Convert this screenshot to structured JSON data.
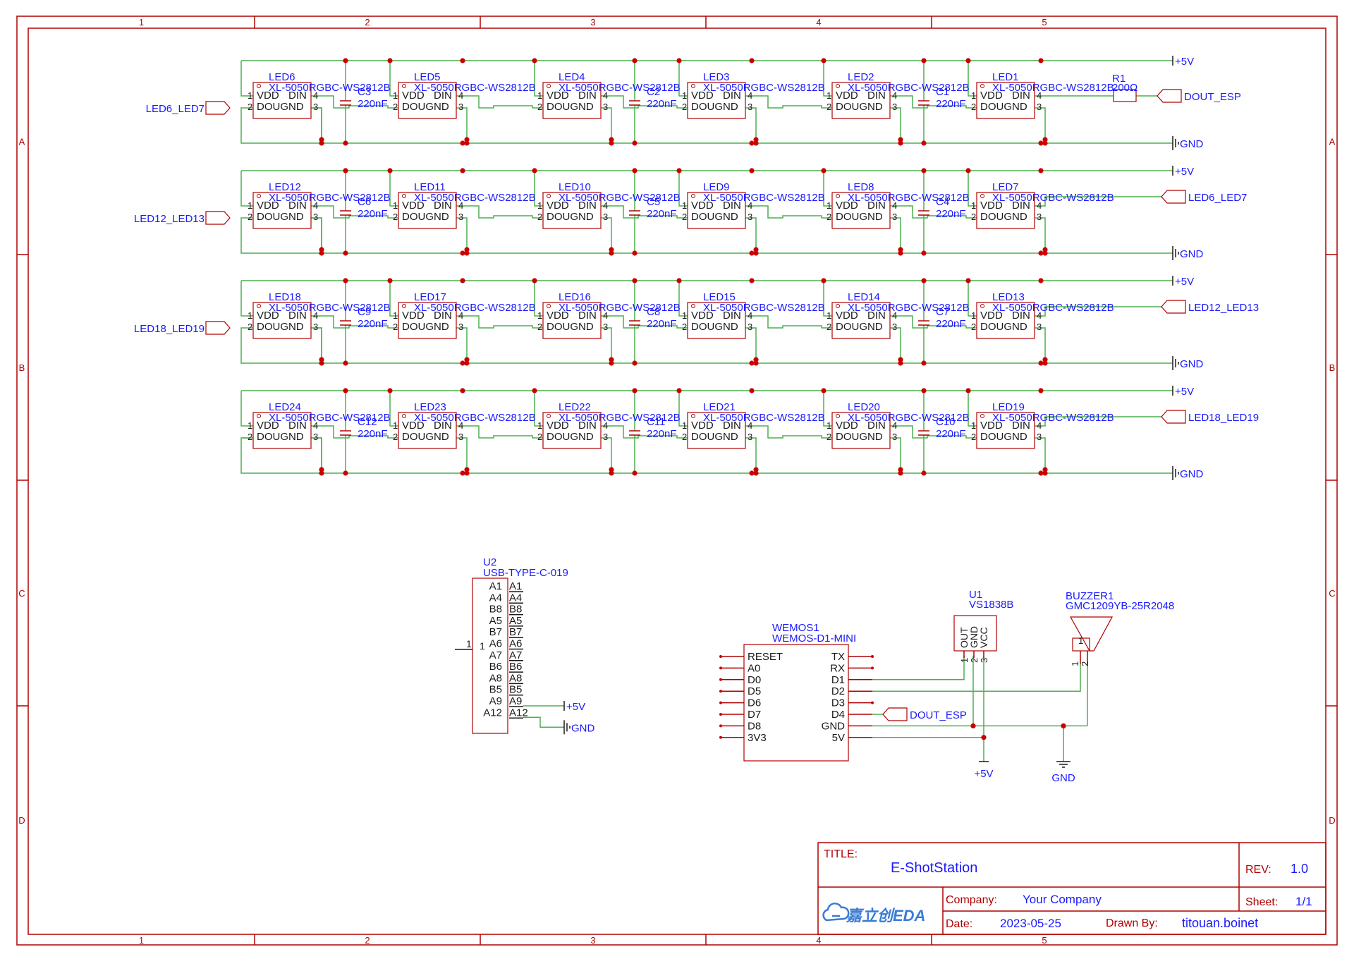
{
  "border": {
    "cols": [
      "1",
      "2",
      "3",
      "4",
      "5"
    ],
    "rows": [
      "A",
      "B",
      "C",
      "D"
    ]
  },
  "colors": {
    "wire": "#4caf50",
    "junction": "#cc0000",
    "frame": "#b00000",
    "label": "#1a1aff",
    "pin": "#1a1a1a"
  },
  "led_rows": [
    {
      "leds": [
        {
          "ref": "LED6",
          "part": "XL-5050RGBC-WS2812B"
        },
        {
          "ref": "LED5",
          "part": "XL-5050RGBC-WS2812B"
        },
        {
          "ref": "LED4",
          "part": "XL-5050RGBC-WS2812B"
        },
        {
          "ref": "LED3",
          "part": "XL-5050RGBC-WS2812B"
        },
        {
          "ref": "LED2",
          "part": "XL-5050RGBC-WS2812B"
        },
        {
          "ref": "LED1",
          "part": "XL-5050RGBC-WS2812B"
        }
      ],
      "caps": [
        {
          "ref": "C3",
          "value": "220nF"
        },
        {
          "ref": "C2",
          "value": "220nF"
        },
        {
          "ref": "C1",
          "value": "220nF"
        }
      ],
      "in_label": "LED6_LED7",
      "out_label": "DOUT_ESP",
      "resistor": {
        "ref": "R1",
        "value": "200Ω"
      },
      "vcc": "+5V",
      "gnd": "GND"
    },
    {
      "leds": [
        {
          "ref": "LED12",
          "part": "XL-5050RGBC-WS2812B"
        },
        {
          "ref": "LED11",
          "part": "XL-5050RGBC-WS2812B"
        },
        {
          "ref": "LED10",
          "part": "XL-5050RGBC-WS2812B"
        },
        {
          "ref": "LED9",
          "part": "XL-5050RGBC-WS2812B"
        },
        {
          "ref": "LED8",
          "part": "XL-5050RGBC-WS2812B"
        },
        {
          "ref": "LED7",
          "part": "XL-5050RGBC-WS2812B"
        }
      ],
      "caps": [
        {
          "ref": "C6",
          "value": "220nF"
        },
        {
          "ref": "C5",
          "value": "220nF"
        },
        {
          "ref": "C4",
          "value": "220nF"
        }
      ],
      "in_label": "LED12_LED13",
      "out_label": "LED6_LED7",
      "vcc": "+5V",
      "gnd": "GND"
    },
    {
      "leds": [
        {
          "ref": "LED18",
          "part": "XL-5050RGBC-WS2812B"
        },
        {
          "ref": "LED17",
          "part": "XL-5050RGBC-WS2812B"
        },
        {
          "ref": "LED16",
          "part": "XL-5050RGBC-WS2812B"
        },
        {
          "ref": "LED15",
          "part": "XL-5050RGBC-WS2812B"
        },
        {
          "ref": "LED14",
          "part": "XL-5050RGBC-WS2812B"
        },
        {
          "ref": "LED13",
          "part": "XL-5050RGBC-WS2812B"
        }
      ],
      "caps": [
        {
          "ref": "C9",
          "value": "220nF"
        },
        {
          "ref": "C8",
          "value": "220nF"
        },
        {
          "ref": "C7",
          "value": "220nF"
        }
      ],
      "in_label": "LED18_LED19",
      "out_label": "LED12_LED13",
      "vcc": "+5V",
      "gnd": "GND"
    },
    {
      "leds": [
        {
          "ref": "LED24",
          "part": "XL-5050RGBC-WS2812B"
        },
        {
          "ref": "LED23",
          "part": "XL-5050RGBC-WS2812B"
        },
        {
          "ref": "LED22",
          "part": "XL-5050RGBC-WS2812B"
        },
        {
          "ref": "LED21",
          "part": "XL-5050RGBC-WS2812B"
        },
        {
          "ref": "LED20",
          "part": "XL-5050RGBC-WS2812B"
        },
        {
          "ref": "LED19",
          "part": "XL-5050RGBC-WS2812B"
        }
      ],
      "caps": [
        {
          "ref": "C12",
          "value": "220nF"
        },
        {
          "ref": "C11",
          "value": "220nF"
        },
        {
          "ref": "C10",
          "value": "220nF"
        }
      ],
      "in_label": "",
      "out_label": "LED18_LED19",
      "vcc": "+5V",
      "gnd": "GND"
    }
  ],
  "led_pins": {
    "vdd": "VDD",
    "din": "DIN",
    "dout": "DOUGND",
    "p1": "1",
    "p2": "2",
    "p3": "3",
    "p4": "4"
  },
  "usb": {
    "ref": "U2",
    "part": "USB-TYPE-C-019",
    "left_pins": [
      "A1",
      "A4",
      "B8",
      "A5",
      "B7",
      "A6",
      "A7",
      "B6",
      "A8",
      "B5",
      "A9",
      "A12"
    ],
    "right_pins": [
      "A1",
      "A4",
      "B8",
      "A5",
      "B7",
      "A6",
      "A7",
      "B6",
      "A8",
      "B5",
      "A9",
      "A12"
    ],
    "pin1": "1",
    "vcc": "+5V",
    "gnd": "GND"
  },
  "wemos": {
    "ref": "WEMOS1",
    "part": "WEMOS-D1-MINI",
    "left_pins": [
      "RESET",
      "A0",
      "D0",
      "D5",
      "D6",
      "D7",
      "D8",
      "3V3"
    ],
    "right_pins": [
      "TX",
      "RX",
      "D1",
      "D2",
      "D3",
      "D4",
      "GND",
      "5V"
    ],
    "d4_label": "DOUT_ESP"
  },
  "ir": {
    "ref": "U1",
    "part": "VS1838B",
    "pins": [
      "OUT",
      "GND",
      "VCC"
    ],
    "nums": [
      "1",
      "2",
      "3"
    ],
    "vcc": "+5V"
  },
  "buzzer": {
    "ref": "BUZZER1",
    "part": "GMC1209YB-25R2048",
    "nums": [
      "1",
      "2"
    ],
    "gnd": "GND"
  },
  "title_block": {
    "title_label": "TITLE:",
    "title": "E-ShotStation",
    "rev_label": "REV:",
    "rev": "1.0",
    "company_label": "Company:",
    "company": "Your Company",
    "sheet_label": "Sheet:",
    "sheet": "1/1",
    "date_label": "Date:",
    "date": "2023-05-25",
    "drawn_label": "Drawn By:",
    "drawn": "titouan.boinet",
    "logo": "嘉立创EDA"
  }
}
